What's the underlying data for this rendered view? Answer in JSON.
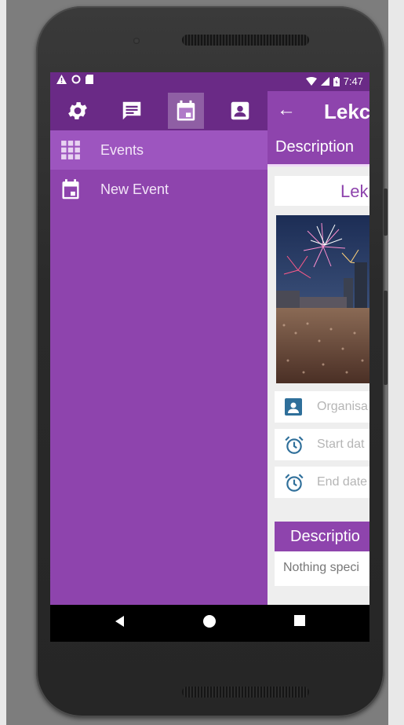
{
  "status_bar": {
    "time": "7:47"
  },
  "drawer": {
    "tabs": [
      {
        "icon": "gear-icon",
        "active": false
      },
      {
        "icon": "message-icon",
        "active": false
      },
      {
        "icon": "calendar-icon",
        "active": true
      },
      {
        "icon": "contact-icon",
        "active": false
      }
    ],
    "items": [
      {
        "label": "Events",
        "icon": "grid-icon",
        "selected": true
      },
      {
        "label": "New Event",
        "icon": "calendar-icon",
        "selected": false
      }
    ]
  },
  "content": {
    "title": "Lekc",
    "tab_label": "Description",
    "event_title": "Lek",
    "organiser_placeholder": "Organisa",
    "start_placeholder": "Start dat",
    "end_placeholder": "End date",
    "description_header": "Descriptio",
    "description_text": "Nothing speci"
  },
  "colors": {
    "primary": "#8e44ad",
    "primary_dark": "#6a2a86",
    "selected_item": "#9d55bf",
    "icon_blue": "#2f6f9a"
  }
}
